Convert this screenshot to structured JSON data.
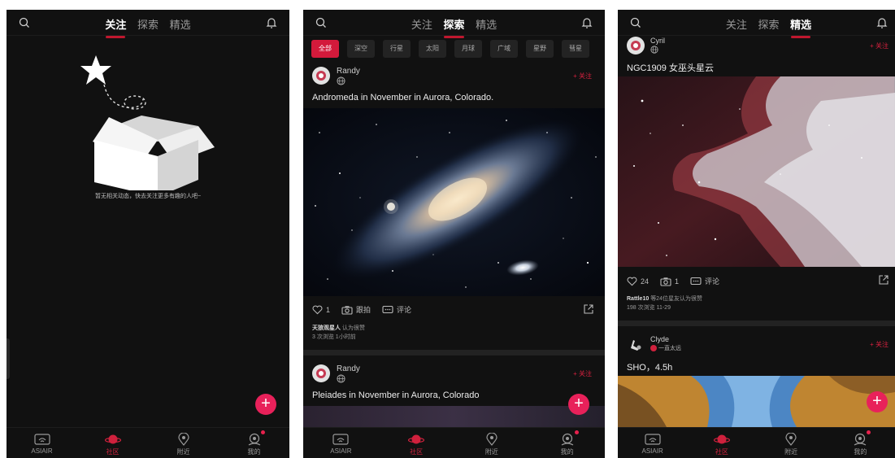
{
  "screens": {
    "follow": {
      "tabs": [
        "关注",
        "探索",
        "精选"
      ],
      "active_tab": "关注",
      "empty_text": "暂无相关动态，快去关注更多有趣的人吧~",
      "fab": "+"
    },
    "explore": {
      "tabs": [
        "关注",
        "探索",
        "精选"
      ],
      "active_tab": "探索",
      "chips": [
        "全部",
        "深空",
        "行星",
        "太阳",
        "月球",
        "广域",
        "星野",
        "彗星"
      ],
      "active_chip": "全部",
      "post1": {
        "username": "Randy",
        "follow": "+ 关注",
        "title": "Andromeda in November in Aurora, Colorado.",
        "likes": "1",
        "action_same": "跟拍",
        "action_comment": "评论",
        "recognized_by": "天狼观星人",
        "recognized_suffix": "认为很赞",
        "views": "3 次浏览",
        "time": "1小时前"
      },
      "post2": {
        "username": "Randy",
        "follow": "+ 关注",
        "title": "Pleiades in November in Aurora, Colorado"
      },
      "fab": "+"
    },
    "featured": {
      "tabs": [
        "关注",
        "探索",
        "精选"
      ],
      "active_tab": "精选",
      "post1": {
        "username": "Cyril",
        "follow": "+ 关注",
        "title": "NGC1909 女巫头星云",
        "likes": "24",
        "same_count": "1",
        "action_comment": "评论",
        "recognized_by": "Rattle10",
        "recognized_suffix": "等24位星友认为很赞",
        "views": "198 次浏览",
        "time": "11-29"
      },
      "post2": {
        "username": "Clyde",
        "follow": "+ 关注",
        "location": "一直太远",
        "title": "SHO，4.5h"
      },
      "fab": "+"
    }
  },
  "bottom_nav": [
    "ASIAIR",
    "社区",
    "附近",
    "我的"
  ],
  "active_nav": "社区",
  "colors": {
    "accent": "#d31a3b",
    "background": "#111111",
    "fab": "#e8215a"
  },
  "icons": [
    "search-icon",
    "bell-icon",
    "heart-icon",
    "camera-icon",
    "comment-icon",
    "share-icon",
    "globe-icon"
  ]
}
